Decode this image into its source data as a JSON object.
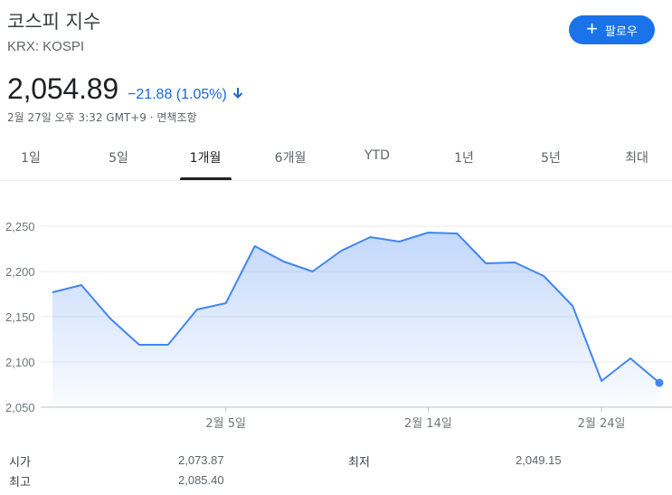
{
  "header": {
    "title": "코스피 지수",
    "ticker": "KRX: KOSPI",
    "follow_label": "팔로우"
  },
  "quote": {
    "price": "2,054.89",
    "change": "−21.88 (1.05%)",
    "direction": "down",
    "timestamp": "2월 27일 오후 3:32 GMT+9 · 면책조항"
  },
  "tabs": [
    {
      "label": "1일",
      "active": false
    },
    {
      "label": "5일",
      "active": false
    },
    {
      "label": "1개월",
      "active": true
    },
    {
      "label": "6개월",
      "active": false
    },
    {
      "label": "YTD",
      "active": false
    },
    {
      "label": "1년",
      "active": false
    },
    {
      "label": "5년",
      "active": false
    },
    {
      "label": "최대",
      "active": false
    }
  ],
  "colors": {
    "accent": "#1a73e8",
    "line": "#4285f4",
    "down": "#1967d2"
  },
  "chart_data": {
    "type": "area",
    "y_ticks": [
      "2,250",
      "2,200",
      "2,150",
      "2,100",
      "2,050"
    ],
    "ylim": [
      2050,
      2250
    ],
    "x_labels": [
      {
        "index": 6,
        "label": "2월 5일"
      },
      {
        "index": 13,
        "label": "2월 14일"
      },
      {
        "index": 19,
        "label": "2월 24일"
      }
    ],
    "values": [
      2177,
      2185,
      2148,
      2119,
      2119,
      2158,
      2165,
      2228,
      2211,
      2200,
      2223,
      2238,
      2233,
      2243,
      2242,
      2209,
      2210,
      2195,
      2162,
      2079,
      2104,
      2077
    ],
    "grid": true
  },
  "stats": {
    "open_label": "시가",
    "open_value": "2,073.87",
    "high_label": "최고",
    "high_value": "2,085.40",
    "low_label": "최저",
    "low_value": "2,049.15"
  }
}
